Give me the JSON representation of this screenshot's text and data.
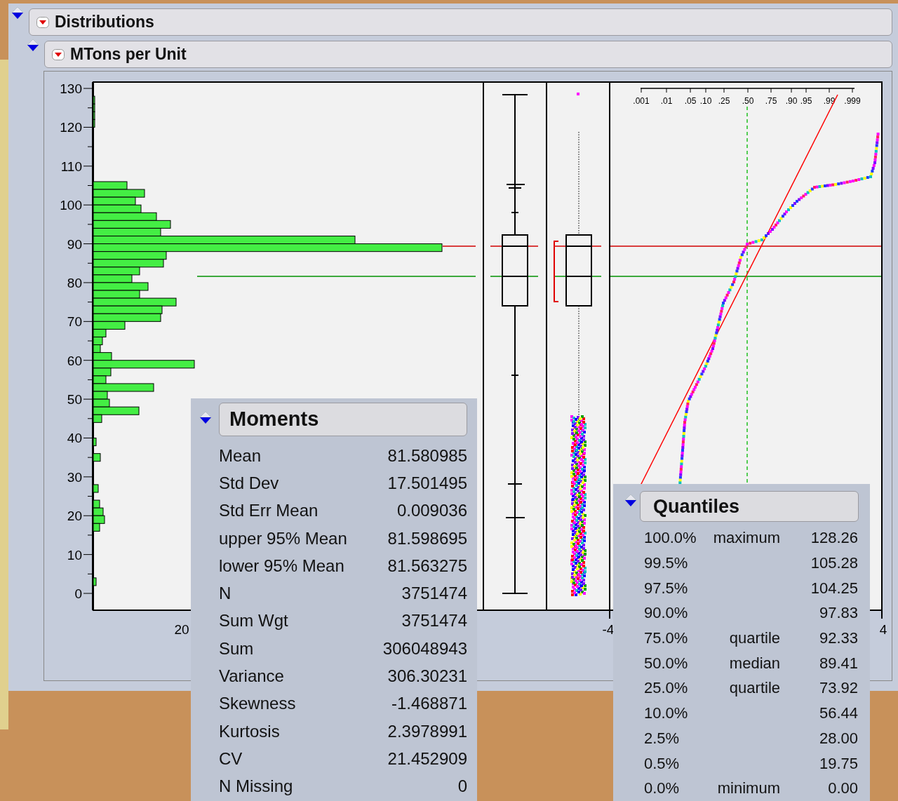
{
  "report": {
    "title": "Distributions",
    "expanded": true
  },
  "variable": {
    "title": "MTons per Unit",
    "expanded": true
  },
  "y_axis": {
    "ticks": [
      "130",
      "120",
      "110",
      "100",
      "90",
      "80",
      "70",
      "60",
      "50",
      "40",
      "30",
      "20",
      "10",
      "0"
    ]
  },
  "x_axis_labels": [
    "20",
    "-4",
    "4"
  ],
  "probability_scale": [
    ".001",
    ".01",
    ".05",
    ".10",
    ".25",
    ".50",
    ".75",
    ".90",
    ".95",
    ".99",
    ".999"
  ],
  "moments": {
    "title": "Moments",
    "expanded": true,
    "rows": [
      {
        "label": "Mean",
        "value": "81.580985"
      },
      {
        "label": "Std Dev",
        "value": "17.501495"
      },
      {
        "label": "Std Err Mean",
        "value": "0.009036"
      },
      {
        "label": "upper 95% Mean",
        "value": "81.598695"
      },
      {
        "label": "lower 95% Mean",
        "value": "81.563275"
      },
      {
        "label": "N",
        "value": "3751474"
      },
      {
        "label": "Sum Wgt",
        "value": "3751474"
      },
      {
        "label": "Sum",
        "value": "306048943"
      },
      {
        "label": "Variance",
        "value": "306.30231"
      },
      {
        "label": "Skewness",
        "value": "-1.468871"
      },
      {
        "label": "Kurtosis",
        "value": "2.3978991"
      },
      {
        "label": "CV",
        "value": "21.452909"
      },
      {
        "label": "N Missing",
        "value": "0"
      }
    ]
  },
  "quantiles": {
    "title": "Quantiles",
    "expanded": true,
    "rows": [
      {
        "percent": "100.0%",
        "label": "maximum",
        "value": "128.26"
      },
      {
        "percent": "99.5%",
        "value": "105.28"
      },
      {
        "percent": "97.5%",
        "value": "104.25"
      },
      {
        "percent": "90.0%",
        "value": "97.83"
      },
      {
        "percent": "75.0%",
        "label": "quartile",
        "value": "92.33"
      },
      {
        "percent": "50.0%",
        "label": "median",
        "value": "89.41"
      },
      {
        "percent": "25.0%",
        "label": "quartile",
        "value": "73.92"
      },
      {
        "percent": "10.0%",
        "value": "56.44"
      },
      {
        "percent": "2.5%",
        "value": "28.00"
      },
      {
        "percent": "0.5%",
        "value": "19.75"
      },
      {
        "percent": "0.0%",
        "label": "minimum",
        "value": "0.00"
      }
    ]
  }
}
